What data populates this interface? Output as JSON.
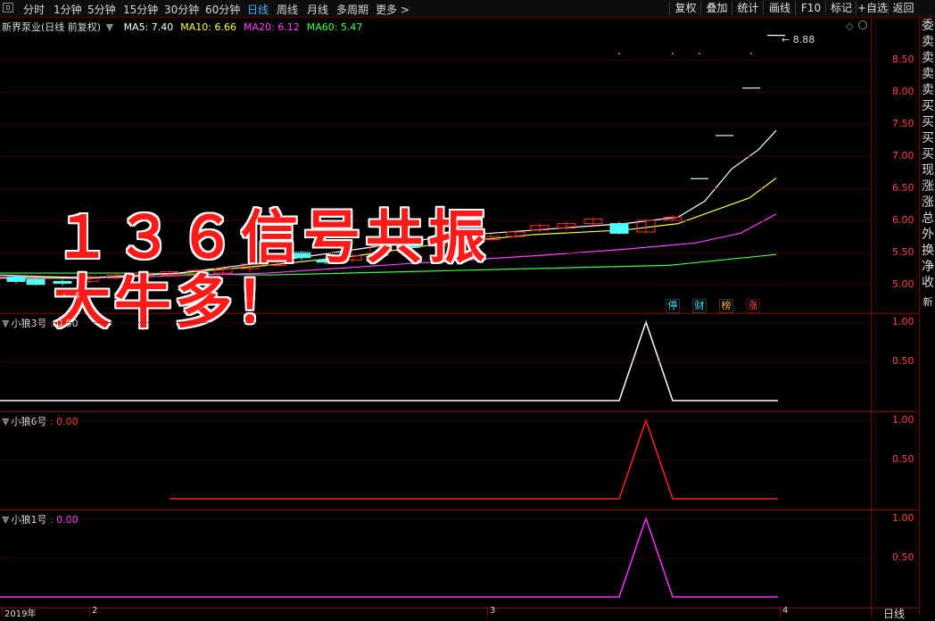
{
  "toolbar": {
    "periods": [
      "分时",
      "1分钟",
      "5分钟",
      "15分钟",
      "30分钟",
      "60分钟",
      "日线",
      "周线",
      "月线",
      "多周期",
      "更多 >"
    ],
    "active": "日线",
    "buttons": [
      "复权",
      "叠加",
      "统计",
      "画线",
      "F10",
      "标记",
      "+自选",
      "返回"
    ]
  },
  "main": {
    "title": "新界泵业(日线 前复权)",
    "ma": [
      {
        "label": "MA5: 7.40",
        "color": "#ffffff"
      },
      {
        "label": "MA10: 6.66",
        "color": "#ffff40"
      },
      {
        "label": "MA20: 6.12",
        "color": "#ff40ff"
      },
      {
        "label": "MA60: 5.47",
        "color": "#40ff40"
      }
    ],
    "ticks": [
      "8.50",
      "8.00",
      "7.50",
      "7.00",
      "6.50",
      "6.00",
      "5.50",
      "5.00"
    ],
    "high_label": "8.88",
    "low_label": "4",
    "badges": [
      {
        "text": "停",
        "color": "#40e0ff"
      },
      {
        "text": "财",
        "color": "#40e0ff"
      },
      {
        "text": "榜",
        "color": "#ffb040"
      },
      {
        "text": "涨",
        "color": "#ff4040"
      }
    ]
  },
  "overlay": {
    "line1": "１３６信号共振",
    "line2": "大牛多！"
  },
  "sub1": {
    "name": "小狼3号",
    "value": "0.00",
    "color": "#ffffff",
    "ticks": [
      "1.00",
      "0.50"
    ]
  },
  "sub2": {
    "name": "小狼6号",
    "value": "0.00",
    "color": "#ff2020",
    "ticks": [
      "1.00",
      "0.50"
    ]
  },
  "sub3": {
    "name": "小狼1号",
    "value": "0.00",
    "color": "#ff30ff",
    "ticks": [
      "1.00",
      "0.50"
    ]
  },
  "right_strip": [
    "委",
    "卖",
    "卖",
    "卖",
    "卖",
    "买",
    "买",
    "买",
    "买",
    "现",
    "涨",
    "涨",
    "总",
    "外",
    "换",
    "净",
    "收",
    "新"
  ],
  "time_axis": [
    "2019年",
    "2",
    "3",
    "4"
  ],
  "bottom_label": "日线"
}
